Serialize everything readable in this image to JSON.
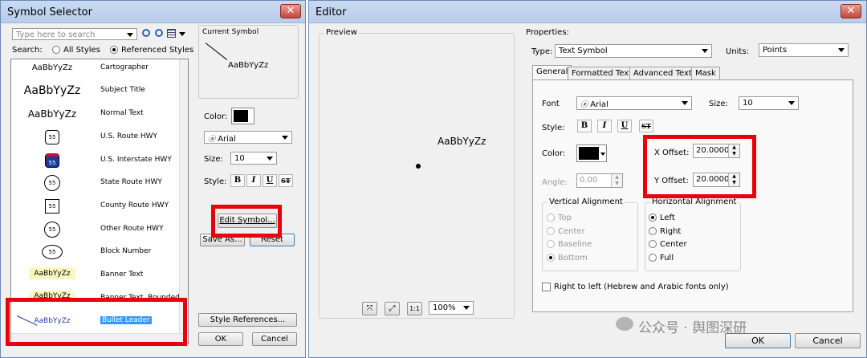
{
  "symbol_selector": {
    "title": "Symbol Selector",
    "close_glyph": "✕",
    "search_placeholder": "Type here to search",
    "search_label": "Search:",
    "all_styles": "All Styles",
    "referenced_styles": "Referenced Styles",
    "current_symbol_label": "Current Symbol",
    "preview_text": "AaBbYyZz",
    "color_label": "Color:",
    "font_value": "Arial",
    "size_label": "Size:",
    "size_value": "10",
    "style_label": "Style:",
    "style_buttons": [
      "B",
      "I",
      "U",
      "ST"
    ],
    "edit_symbol": "Edit Symbol...",
    "save_as": "Save As...",
    "reset": "Reset",
    "style_references": "Style References...",
    "ok": "OK",
    "cancel": "Cancel",
    "symbols": [
      {
        "preview": "AaBbYyZz",
        "name": "Cartographer"
      },
      {
        "preview": "AaBbYyZz",
        "name": "Subject Title"
      },
      {
        "preview": "AaBbYyZz",
        "name": "Normal Text"
      },
      {
        "preview": "55",
        "name": "U.S. Route HWY"
      },
      {
        "preview": "55",
        "name": "U.S. Interstate HWY"
      },
      {
        "preview": "55",
        "name": "State Route HWY"
      },
      {
        "preview": "55",
        "name": "County Route HWY"
      },
      {
        "preview": "55",
        "name": "Other Route HWY"
      },
      {
        "preview": "55",
        "name": "Block Number"
      },
      {
        "preview": "AaBbYyZz",
        "name": "Banner Text"
      },
      {
        "preview": "AaBbYyZz",
        "name": "Banner Text, Rounded"
      },
      {
        "preview": "AaBbYyZz",
        "name": "Bullet Leader"
      }
    ]
  },
  "editor": {
    "title": "Editor",
    "close_glyph": "✕",
    "preview_label": "Preview",
    "preview_text": "AaBbYyZz",
    "zoom_value": "100%",
    "zoom_icons": [
      "⤧",
      "⤢",
      "1:1"
    ],
    "properties_label": "Properties:",
    "type_label": "Type:",
    "type_value": "Text Symbol",
    "units_label": "Units:",
    "units_value": "Points",
    "tabs": [
      "General",
      "Formatted Text",
      "Advanced Text",
      "Mask"
    ],
    "font_label": "Font",
    "font_value": "Arial",
    "size_label": "Size:",
    "size_value": "10",
    "style_label": "Style:",
    "style_buttons": [
      "B",
      "I",
      "U",
      "ST"
    ],
    "color_label": "Color:",
    "angle_label": "Angle:",
    "angle_value": "0.00",
    "x_offset_label": "X Offset:",
    "x_offset_value": "20.0000",
    "y_offset_label": "Y Offset:",
    "y_offset_value": "20.0000",
    "vertical_alignment_label": "Vertical Alignment",
    "vertical_options": [
      "Top",
      "Center",
      "Baseline",
      "Bottom"
    ],
    "horizontal_alignment_label": "Horizontal Alignment",
    "horizontal_options": [
      "Left",
      "Right",
      "Center",
      "Full"
    ],
    "rtl_label": "Right to left (Hebrew and Arabic fonts only)",
    "ok": "OK",
    "cancel": "Cancel",
    "watermark": "公众号 · 舆图深研"
  },
  "colors": {
    "highlight_red": "#e8000c",
    "selection_blue": "#3399ff"
  }
}
